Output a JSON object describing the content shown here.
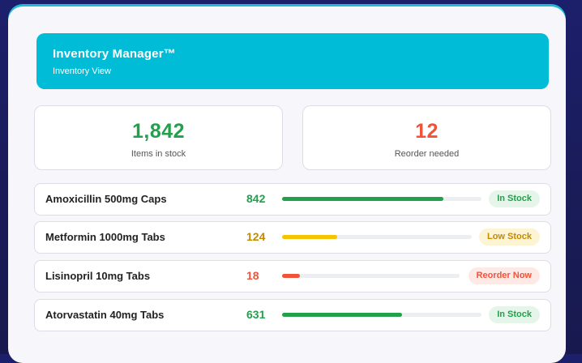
{
  "header": {
    "title": "Inventory Manager™",
    "subtitle": "Inventory View"
  },
  "stats": [
    {
      "value": "1,842",
      "label": "Items in stock",
      "color": "#22a04b"
    },
    {
      "value": "12",
      "label": "Reorder needed",
      "color": "#f0533a"
    }
  ],
  "items": [
    {
      "name": "Amoxicillin 500mg Caps",
      "qty": "842",
      "level": 0.81,
      "status": "In Stock",
      "color": "#22a04b",
      "badge_bg": "#e5f5e9"
    },
    {
      "name": "Metformin 1000mg Tabs",
      "qty": "124",
      "level": 0.29,
      "status": "Low Stock",
      "color": "#c28a00",
      "bar_color": "#f5c400",
      "badge_bg": "#fdf4d3"
    },
    {
      "name": "Lisinopril 10mg Tabs",
      "qty": "18",
      "level": 0.1,
      "status": "Reorder Now",
      "color": "#f0533a",
      "badge_bg": "#fde9e5"
    },
    {
      "name": "Atorvastatin 40mg Tabs",
      "qty": "631",
      "level": 0.6,
      "status": "In Stock",
      "color": "#22a04b",
      "badge_bg": "#e5f5e9"
    }
  ]
}
